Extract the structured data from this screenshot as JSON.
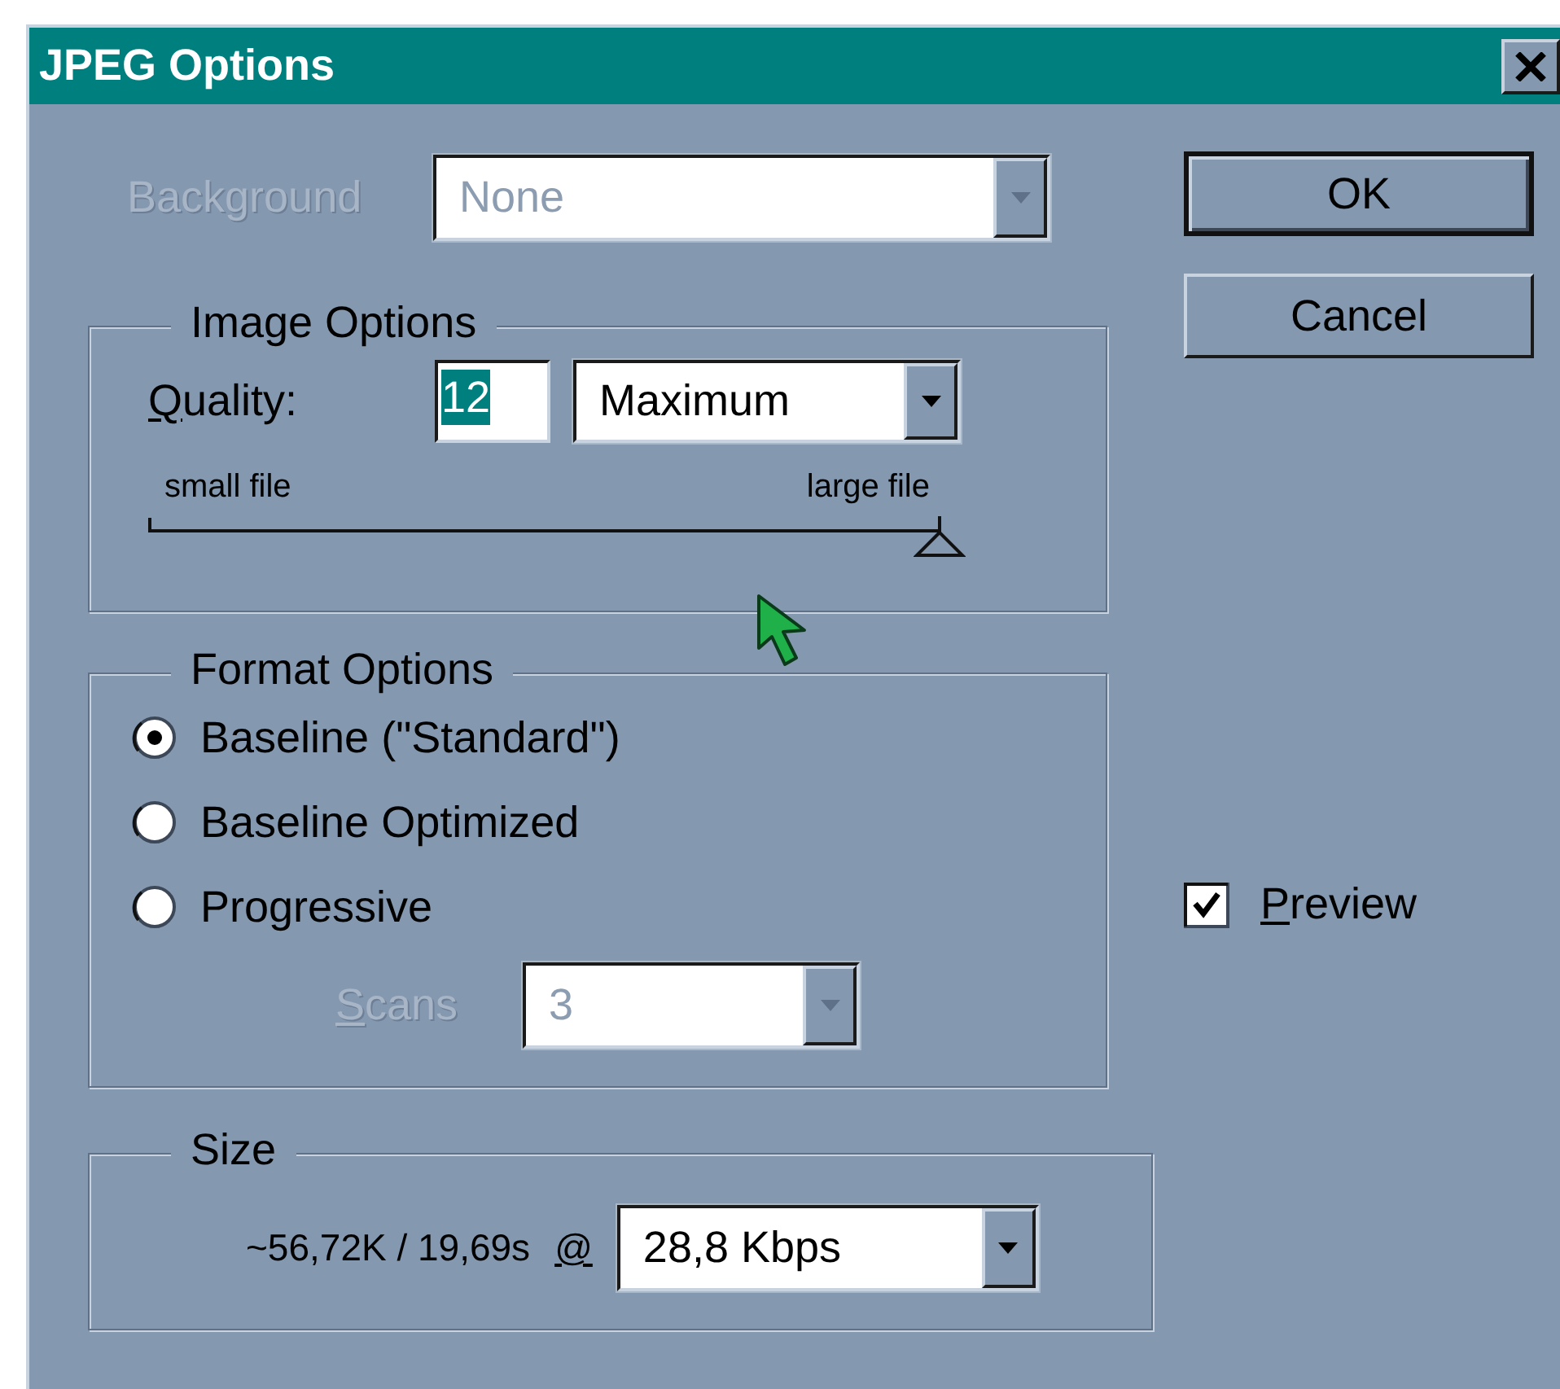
{
  "window": {
    "title": "JPEG Options"
  },
  "background": {
    "label": "Background",
    "value": "None",
    "disabled": true
  },
  "image_options": {
    "title": "Image Options",
    "quality": {
      "label": "Quality:",
      "mnemonic": true,
      "value": "12",
      "value_selected": true,
      "preset": "Maximum"
    },
    "slider": {
      "min_label": "small file",
      "max_label": "large file",
      "level": 1
    }
  },
  "format_options": {
    "title": "Format Options",
    "radios": [
      {
        "label": "Baseline (\"Standard\")",
        "selected": true
      },
      {
        "label": "Baseline Optimized",
        "selected": false
      },
      {
        "label": "Progressive",
        "selected": false
      }
    ],
    "scans": {
      "label": "Scans",
      "mnemonic": true,
      "value": "3",
      "disabled": true
    }
  },
  "size": {
    "title": "Size",
    "estimate": "~56,72K / 19,69s",
    "at": {
      "label": "@",
      "mnemonic": true
    },
    "speed": "28,8 Kbps"
  },
  "buttons": [
    {
      "label": "OK",
      "default": true
    },
    {
      "label": "Cancel",
      "default": false
    }
  ],
  "preview": {
    "label": "Preview",
    "mnemonic": true,
    "checked": true
  }
}
